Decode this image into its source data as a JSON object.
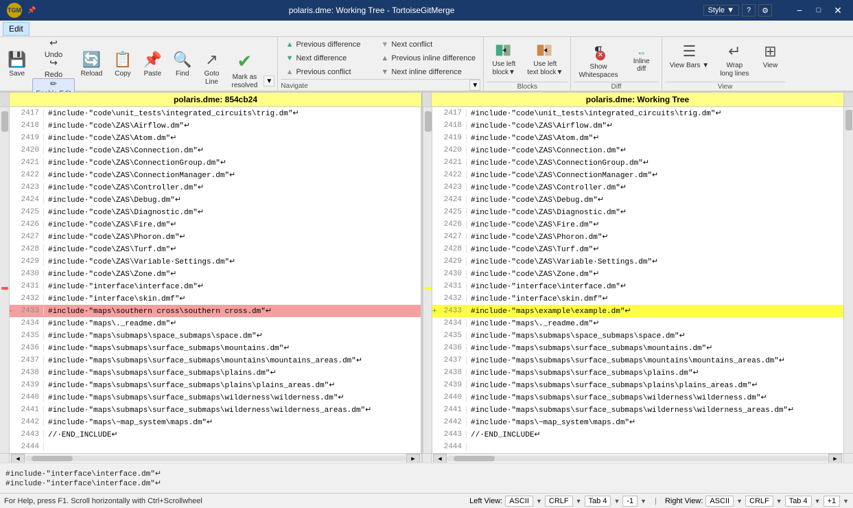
{
  "window": {
    "title": "polaris.dme: Working Tree - TortoiseGitMerge",
    "icon": "TGM",
    "controls": [
      "minimize",
      "maximize",
      "close"
    ],
    "style_btn": "Style ▼",
    "help_btn": "?",
    "settings_btn": "⚙"
  },
  "menu": {
    "items": [
      "Edit"
    ]
  },
  "toolbar": {
    "edit_group": {
      "label": "Edit",
      "save_label": "Save",
      "reload_label": "Reload",
      "undo_label": "Undo",
      "redo_label": "Redo",
      "enable_edit_label": "Enable Edit",
      "copy_label": "Copy",
      "paste_label": "Paste",
      "find_label": "Find",
      "goto_label": "Goto\nLine",
      "mark_label": "Mark as\nresolved"
    },
    "navigate_group": {
      "label": "Navigate",
      "prev_diff": "Previous difference",
      "next_diff": "Next difference",
      "prev_conflict": "Previous conflict",
      "next_conflict": "Next conflict",
      "prev_inline": "Previous inline difference",
      "next_inline": "Next inline difference"
    },
    "blocks_group": {
      "label": "Blocks",
      "use_left_block": "Use left\nblock▼",
      "use_left_text": "Use left\ntext block▼"
    },
    "diff_group": {
      "label": "Diff",
      "show_whitespace": "Show\nWhitespaces",
      "inline_diff": "Inline\ndiff"
    },
    "view_group": {
      "label": "View",
      "view_bars": "View\nBars ▼",
      "wrap_long": "Wrap\nlong lines",
      "view_icon": "View"
    }
  },
  "left_pane": {
    "title": "polaris.dme: 854cb24",
    "lines": [
      {
        "num": "2417",
        "code": "#include·\"code\\unit_tests\\integrated_circuits\\trig.dm\"↵",
        "type": "normal"
      },
      {
        "num": "2418",
        "code": "#include·\"code\\ZAS\\Airflow.dm\"↵",
        "type": "normal"
      },
      {
        "num": "2419",
        "code": "#include·\"code\\ZAS\\Atom.dm\"↵",
        "type": "normal"
      },
      {
        "num": "2420",
        "code": "#include·\"code\\ZAS\\Connection.dm\"↵",
        "type": "normal"
      },
      {
        "num": "2421",
        "code": "#include·\"code\\ZAS\\ConnectionGroup.dm\"↵",
        "type": "normal"
      },
      {
        "num": "2422",
        "code": "#include·\"code\\ZAS\\ConnectionManager.dm\"↵",
        "type": "normal"
      },
      {
        "num": "2423",
        "code": "#include·\"code\\ZAS\\Controller.dm\"↵",
        "type": "normal"
      },
      {
        "num": "2424",
        "code": "#include·\"code\\ZAS\\Debug.dm\"↵",
        "type": "normal"
      },
      {
        "num": "2425",
        "code": "#include·\"code\\ZAS\\Diagnostic.dm\"↵",
        "type": "normal"
      },
      {
        "num": "2426",
        "code": "#include·\"code\\ZAS\\Fire.dm\"↵",
        "type": "normal"
      },
      {
        "num": "2427",
        "code": "#include·\"code\\ZAS\\Phoron.dm\"↵",
        "type": "normal"
      },
      {
        "num": "2428",
        "code": "#include·\"code\\ZAS\\Turf.dm\"↵",
        "type": "normal"
      },
      {
        "num": "2429",
        "code": "#include·\"code\\ZAS\\Variable·Settings.dm\"↵",
        "type": "normal"
      },
      {
        "num": "2430",
        "code": "#include·\"code\\ZAS\\Zone.dm\"↵",
        "type": "normal"
      },
      {
        "num": "2431",
        "code": "#include·\"interface\\interface.dm\"↵",
        "type": "normal"
      },
      {
        "num": "2432",
        "code": "#include·\"interface\\skin.dmf\"↵",
        "type": "normal"
      },
      {
        "num": "2433",
        "code": "#include·\"maps\\southern cross\\southern cross.dm\"↵",
        "type": "changed"
      },
      {
        "num": "2434",
        "code": "#include·\"maps\\._readme.dm\"↵",
        "type": "normal"
      },
      {
        "num": "2435",
        "code": "#include·\"maps\\submaps\\space_submaps\\space.dm\"↵",
        "type": "normal"
      },
      {
        "num": "2436",
        "code": "#include·\"maps\\submaps\\surface_submaps\\mountains.dm\"↵",
        "type": "normal"
      },
      {
        "num": "2437",
        "code": "#include·\"maps\\submaps\\surface_submaps\\mountains\\mountains_areas.dm\"↵",
        "type": "normal"
      },
      {
        "num": "2438",
        "code": "#include·\"maps\\submaps\\surface_submaps\\plains.dm\"↵",
        "type": "normal"
      },
      {
        "num": "2439",
        "code": "#include·\"maps\\submaps\\surface_submaps\\plains\\plains_areas.dm\"↵",
        "type": "normal"
      },
      {
        "num": "2440",
        "code": "#include·\"maps\\submaps\\surface_submaps\\wilderness\\wilderness.dm\"↵",
        "type": "normal"
      },
      {
        "num": "2441",
        "code": "#include·\"maps\\submaps\\surface_submaps\\wilderness\\wilderness_areas.dm\"↵",
        "type": "normal"
      },
      {
        "num": "2442",
        "code": "#include·\"maps\\~map_system\\maps.dm\"↵",
        "type": "normal"
      },
      {
        "num": "2443",
        "code": "//·END_INCLUDE↵",
        "type": "normal"
      },
      {
        "num": "2444",
        "code": "",
        "type": "normal"
      }
    ]
  },
  "right_pane": {
    "title": "polaris.dme: Working Tree",
    "lines": [
      {
        "num": "2417",
        "code": "#include·\"code\\unit_tests\\integrated_circuits\\trig.dm\"↵",
        "type": "normal"
      },
      {
        "num": "2418",
        "code": "#include·\"code\\ZAS\\Airflow.dm\"↵",
        "type": "normal"
      },
      {
        "num": "2419",
        "code": "#include·\"code\\ZAS\\Atom.dm\"↵",
        "type": "normal"
      },
      {
        "num": "2420",
        "code": "#include·\"code\\ZAS\\Connection.dm\"↵",
        "type": "normal"
      },
      {
        "num": "2421",
        "code": "#include·\"code\\ZAS\\ConnectionGroup.dm\"↵",
        "type": "normal"
      },
      {
        "num": "2422",
        "code": "#include·\"code\\ZAS\\ConnectionManager.dm\"↵",
        "type": "normal"
      },
      {
        "num": "2423",
        "code": "#include·\"code\\ZAS\\Controller.dm\"↵",
        "type": "normal"
      },
      {
        "num": "2424",
        "code": "#include·\"code\\ZAS\\Debug.dm\"↵",
        "type": "normal"
      },
      {
        "num": "2425",
        "code": "#include·\"code\\ZAS\\Diagnostic.dm\"↵",
        "type": "normal"
      },
      {
        "num": "2426",
        "code": "#include·\"code\\ZAS\\Fire.dm\"↵",
        "type": "normal"
      },
      {
        "num": "2427",
        "code": "#include·\"code\\ZAS\\Phoron.dm\"↵",
        "type": "normal"
      },
      {
        "num": "2428",
        "code": "#include·\"code\\ZAS\\Turf.dm\"↵",
        "type": "normal"
      },
      {
        "num": "2429",
        "code": "#include·\"code\\ZAS\\Variable·Settings.dm\"↵",
        "type": "normal"
      },
      {
        "num": "2430",
        "code": "#include·\"code\\ZAS\\Zone.dm\"↵",
        "type": "normal"
      },
      {
        "num": "2431",
        "code": "#include·\"interface\\interface.dm\"↵",
        "type": "normal"
      },
      {
        "num": "2432",
        "code": "#include·\"interface\\skin.dmf\"↵",
        "type": "normal"
      },
      {
        "num": "2433",
        "code": "#include·\"maps\\example\\example.dm\"↵",
        "type": "added"
      },
      {
        "num": "2434",
        "code": "#include·\"maps\\._readme.dm\"↵",
        "type": "normal"
      },
      {
        "num": "2435",
        "code": "#include·\"maps\\submaps\\space_submaps\\space.dm\"↵",
        "type": "normal"
      },
      {
        "num": "2436",
        "code": "#include·\"maps\\submaps\\surface_submaps\\mountains.dm\"↵",
        "type": "normal"
      },
      {
        "num": "2437",
        "code": "#include·\"maps\\submaps\\surface_submaps\\mountains\\mountains_areas.dm\"↵",
        "type": "normal"
      },
      {
        "num": "2438",
        "code": "#include·\"maps\\submaps\\surface_submaps\\plains.dm\"↵",
        "type": "normal"
      },
      {
        "num": "2439",
        "code": "#include·\"maps\\submaps\\surface_submaps\\plains\\plains_areas.dm\"↵",
        "type": "normal"
      },
      {
        "num": "2440",
        "code": "#include·\"maps\\submaps\\surface_submaps\\wilderness\\wilderness.dm\"↵",
        "type": "normal"
      },
      {
        "num": "2441",
        "code": "#include·\"maps\\submaps\\surface_submaps\\wilderness\\wilderness_areas.dm\"↵",
        "type": "normal"
      },
      {
        "num": "2442",
        "code": "#include·\"maps\\~map_system\\maps.dm\"↵",
        "type": "normal"
      },
      {
        "num": "2443",
        "code": "//·END_INCLUDE↵",
        "type": "normal"
      },
      {
        "num": "2444",
        "code": "",
        "type": "normal"
      }
    ]
  },
  "bottom": {
    "info_line1": "#include·\"interface\\interface.dm\"↵",
    "info_line2": "#include·\"interface\\interface.dm\"↵",
    "status": "For Help, press F1. Scroll horizontally with Ctrl+Scrollwheel",
    "left_enc": "Left View:",
    "left_ascii": "ASCII",
    "left_crlf": "CRLF",
    "left_tab": "Tab 4",
    "left_val": "-1",
    "right_enc": "Right View:",
    "right_ascii": "ASCII",
    "right_crlf": "CRLF",
    "right_tab": "Tab 4",
    "right_val": "+1"
  }
}
